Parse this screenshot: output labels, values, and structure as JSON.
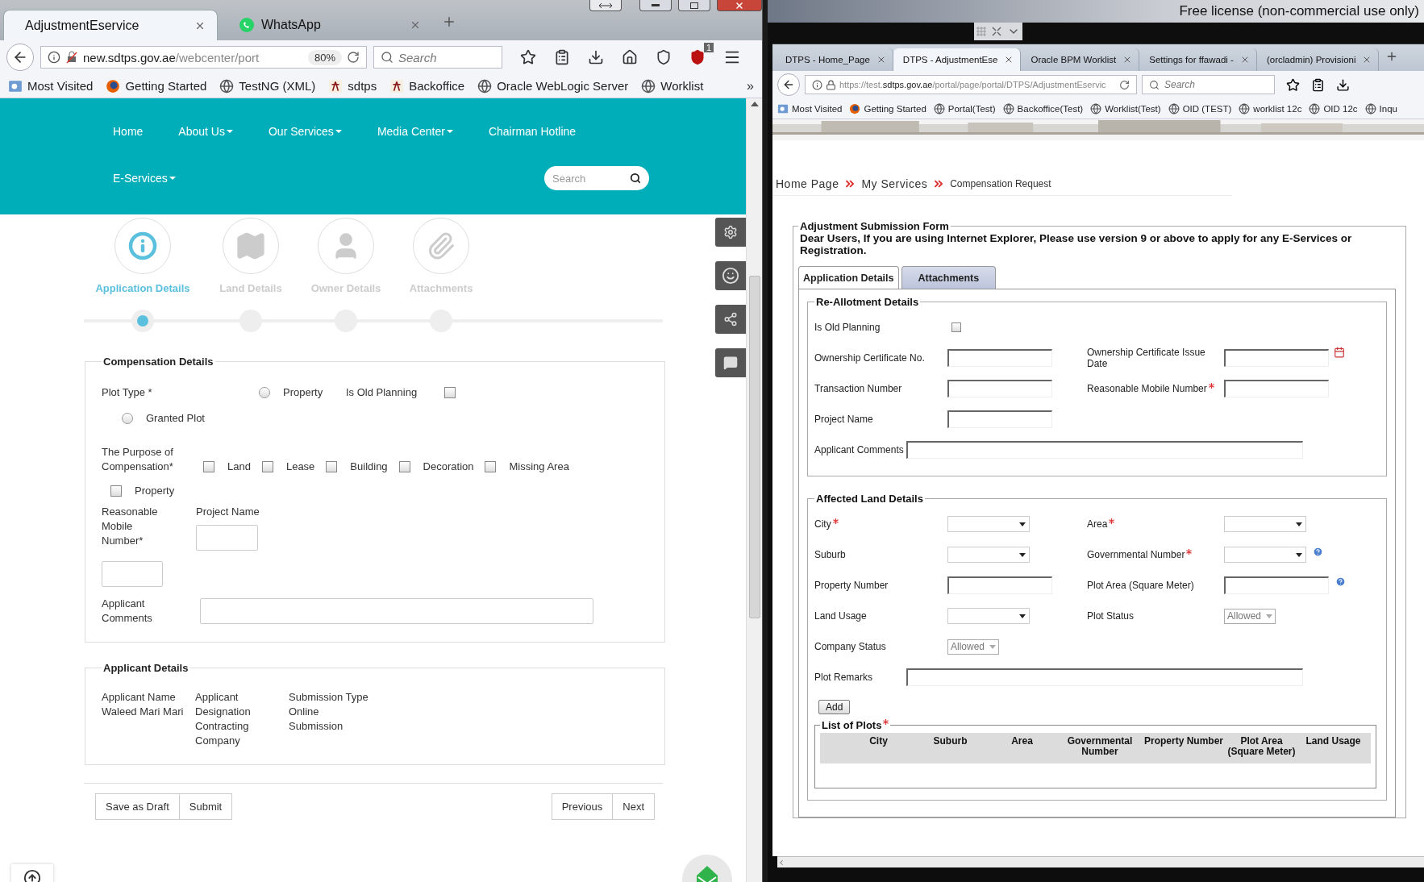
{
  "desktop": {
    "notice": "Free license (non-commercial use only)"
  },
  "left_browser": {
    "tabs": [
      {
        "label": "AdjustmentEservice",
        "selected": true,
        "kind": "plain"
      },
      {
        "label": "WhatsApp",
        "selected": false,
        "kind": "whatsapp"
      }
    ],
    "url": {
      "host": "new.sdtps.gov.ae",
      "path": "/webcenter/port"
    },
    "zoom": "80%",
    "search": {
      "placeholder": "Search"
    },
    "badge": "1",
    "bookmarks": [
      {
        "label": "Most Visited",
        "kind": "folder"
      },
      {
        "label": "Getting Started",
        "kind": "firefox"
      },
      {
        "label": "TestNG (XML)",
        "kind": "globe"
      },
      {
        "label": "sdtps",
        "kind": "logo"
      },
      {
        "label": "Backoffice",
        "kind": "logo"
      },
      {
        "label": "Oracle WebLogic Server",
        "kind": "globe"
      },
      {
        "label": "Worklist",
        "kind": "globe"
      }
    ],
    "more": "»"
  },
  "site": {
    "nav": [
      {
        "label": "Home",
        "dropdown": false
      },
      {
        "label": "About Us",
        "dropdown": true
      },
      {
        "label": "Our Services",
        "dropdown": true
      },
      {
        "label": "Media Center",
        "dropdown": true
      },
      {
        "label": "Chairman Hotline",
        "dropdown": false
      }
    ],
    "nav2": [
      {
        "label": "E-Services",
        "dropdown": true
      }
    ],
    "search": {
      "placeholder": "Search"
    },
    "steps": [
      {
        "label": "Application Details",
        "selected": true,
        "kind": "info"
      },
      {
        "label": "Land Details",
        "selected": false,
        "kind": "map"
      },
      {
        "label": "Owner Details",
        "selected": false,
        "kind": "user"
      },
      {
        "label": "Attachments",
        "selected": false,
        "kind": "clip"
      }
    ],
    "compensation": {
      "title": "Compensation Details",
      "plot_type": {
        "label": "Plot Type *",
        "options": [
          {
            "label": "Property",
            "selected": false
          },
          {
            "label": "Granted Plot",
            "selected": false
          }
        ]
      },
      "old_planning": {
        "label": "Is Old Planning",
        "checked": false
      },
      "purpose": {
        "label": "The Purpose of Compensation*",
        "options": [
          {
            "label": "Land",
            "checked": false
          },
          {
            "label": "Lease",
            "checked": false
          },
          {
            "label": "Building",
            "checked": false
          },
          {
            "label": "Decoration",
            "checked": false
          },
          {
            "label": "Missing Area",
            "checked": false
          },
          {
            "label": "Property",
            "checked": false
          }
        ]
      },
      "mobile": {
        "label": "Reasonable Mobile Number*"
      },
      "project": {
        "label": "Project Name"
      },
      "comments": {
        "label": "Applicant Comments"
      }
    },
    "applicant": {
      "title": "Applicant Details",
      "columns": [
        {
          "label": "Applicant Name",
          "value": "Waleed Mari Mari"
        },
        {
          "label": "Applicant Designation",
          "value": "Contracting Company"
        },
        {
          "label": "Submission Type",
          "value": "Online Submission"
        }
      ]
    },
    "buttons_left": [
      "Save as Draft",
      "Submit"
    ],
    "buttons_right": [
      "Previous",
      "Next"
    ]
  },
  "right_browser": {
    "tabs": [
      {
        "label": "DTPS - Home_Page",
        "selected": false
      },
      {
        "label": "DTPS - AdjustmentEse",
        "selected": true
      },
      {
        "label": "Oracle BPM Worklist",
        "selected": false
      },
      {
        "label": "Settings for ffawadi -",
        "selected": false
      },
      {
        "label": "(orcladmin) Provisioni",
        "selected": false
      }
    ],
    "url": {
      "scheme": "https://test.",
      "host": "sdtps.gov.ae",
      "path": "/portal/page/portal/DTPS/AdjustmentEservic"
    },
    "search": {
      "placeholder": "Search"
    },
    "bookmarks": [
      {
        "label": "Most Visited",
        "kind": "folder"
      },
      {
        "label": "Getting Started",
        "kind": "firefox"
      },
      {
        "label": "Portal(Test)",
        "kind": "globe"
      },
      {
        "label": "Backoffice(Test)",
        "kind": "globe"
      },
      {
        "label": "Worklist(Test)",
        "kind": "globe"
      },
      {
        "label": "OID (TEST)",
        "kind": "globe"
      },
      {
        "label": "worklist 12c",
        "kind": "globe"
      },
      {
        "label": "OID 12c",
        "kind": "globe"
      },
      {
        "label": "Inqu",
        "kind": "globe"
      }
    ]
  },
  "portal": {
    "breadcrumb": [
      {
        "label": "Home Page",
        "kind": "link"
      },
      {
        "label": "My Services",
        "kind": "link"
      },
      {
        "label": "Compensation Request",
        "kind": "current"
      }
    ],
    "form": {
      "title": "Adjustment Submission Form",
      "notice": "Dear Users, If you are using Internet Explorer, Please use version 9 or above to apply for any E-Services or Registration.",
      "tabs": [
        {
          "label": "Application Details",
          "selected": true
        },
        {
          "label": "Attachments",
          "selected": false
        }
      ],
      "sections": [
        {
          "title": "Re-Allotment Details",
          "rows": [
            {
              "fields": [
                {
                  "label": "Is Old Planning",
                  "kind": "checkbox",
                  "checked": false,
                  "required": false
                }
              ]
            },
            {
              "fields": [
                {
                  "label": "Ownership Certificate No.",
                  "kind": "text",
                  "required": false
                },
                {
                  "label": "Ownership Certificate Issue Date",
                  "kind": "date",
                  "required": false
                }
              ]
            },
            {
              "fields": [
                {
                  "label": "Transaction Number",
                  "kind": "text",
                  "required": false
                },
                {
                  "label": "Reasonable Mobile Number",
                  "kind": "text",
                  "required": true
                }
              ]
            },
            {
              "fields": [
                {
                  "label": "Project Name",
                  "kind": "text",
                  "required": false
                }
              ]
            },
            {
              "fields": [
                {
                  "label": "Applicant Comments",
                  "kind": "wide",
                  "required": false
                }
              ]
            }
          ]
        },
        {
          "title": "Affected Land Details",
          "rows": [
            {
              "fields": [
                {
                  "label": "City",
                  "kind": "select",
                  "required": true
                },
                {
                  "label": "Area ",
                  "kind": "select",
                  "required": true
                }
              ]
            },
            {
              "fields": [
                {
                  "label": "Suburb",
                  "kind": "select",
                  "required": false
                },
                {
                  "label": "Governmental Number ",
                  "kind": "select",
                  "required": true,
                  "help": true
                }
              ]
            },
            {
              "fields": [
                {
                  "label": "Property Number",
                  "kind": "text",
                  "required": false
                },
                {
                  "label": "Plot Area (Square Meter)",
                  "kind": "text",
                  "required": false,
                  "help": true
                }
              ]
            },
            {
              "fields": [
                {
                  "label": "Land Usage",
                  "kind": "select",
                  "required": false
                },
                {
                  "label": "Plot Status",
                  "kind": "locked",
                  "value": "Allowed",
                  "required": false
                }
              ]
            },
            {
              "fields": [
                {
                  "label": "Company Status",
                  "kind": "locked",
                  "value": "Allowed",
                  "required": false
                }
              ]
            },
            {
              "fields": [
                {
                  "label": "Plot Remarks",
                  "kind": "wide",
                  "required": false
                }
              ]
            }
          ],
          "add": "Add",
          "plots": {
            "title": "List of Plots",
            "required": true,
            "columns": [
              "City",
              "Suburb",
              "Area",
              "Governmental Number",
              "Property Number",
              "Plot Area (Square Meter)",
              "Land Usage"
            ]
          }
        }
      ]
    }
  }
}
